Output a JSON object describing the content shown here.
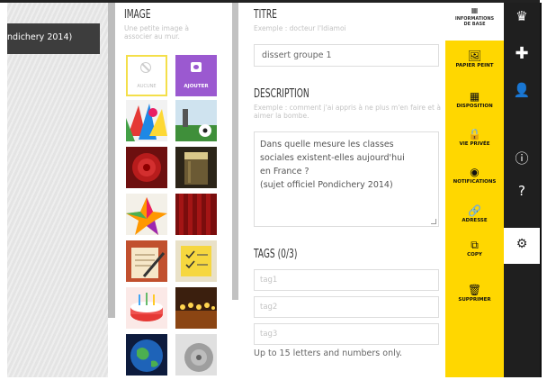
{
  "background_text": "ndichery 2014)",
  "image_section": {
    "title": "IMAGE",
    "hint": "Une petite image à associer au mur.",
    "none_label": "AUCUNE",
    "add_label": "AJOUTER",
    "thumbnails": [
      {
        "name": "thumb-colorful-figures"
      },
      {
        "name": "thumb-soccer"
      },
      {
        "name": "thumb-red-rose"
      },
      {
        "name": "thumb-beer-glass"
      },
      {
        "name": "thumb-origami-star"
      },
      {
        "name": "thumb-red-curtain"
      },
      {
        "name": "thumb-writing"
      },
      {
        "name": "thumb-sticky-note"
      },
      {
        "name": "thumb-birthday-cake"
      },
      {
        "name": "thumb-candles"
      },
      {
        "name": "thumb-earth"
      },
      {
        "name": "thumb-grey-object"
      }
    ]
  },
  "title_section": {
    "title": "TITRE",
    "hint": "Exemple : docteur l'Idiamoi",
    "value": "dissert groupe 1"
  },
  "description_section": {
    "title": "DESCRIPTION",
    "hint": "Exemple : comment j'ai appris à ne plus m'en faire et à aimer la bombe.",
    "lines": [
      "Dans quelle mesure les classes",
      "sociales existent-elles aujourd'hui",
      "en France ?",
      "(sujet officiel Pondichery 2014)"
    ]
  },
  "tags_section": {
    "title": "TAGS (0/3)",
    "placeholders": [
      "tag1",
      "tag2",
      "tag3"
    ],
    "note": "Up to 15 letters and numbers only."
  },
  "menu": {
    "top_label_1": "INFORMATIONS",
    "top_label_2": "DE BASE",
    "items": [
      {
        "label": "PAPIER PEINT",
        "icon": "image-icon"
      },
      {
        "label": "DISPOSITION",
        "icon": "layout-icon"
      },
      {
        "label": "VIE PRIVÉE",
        "icon": "lock-icon"
      },
      {
        "label": "NOTIFICATIONS",
        "icon": "eye-icon"
      },
      {
        "label": "ADRESSE",
        "icon": "link-icon"
      },
      {
        "label": "COPY",
        "icon": "copy-icon"
      },
      {
        "label": "SUPPRIMER",
        "icon": "trash-icon"
      }
    ]
  },
  "sidebar_icons": [
    "crown-icon",
    "plus-icon",
    "user-icon",
    "info-icon",
    "help-icon",
    "gear-icon"
  ],
  "colors": {
    "accent": "#ffd700",
    "dark": "#1f1f1f",
    "add_tile": "#9b59d0",
    "selected_border": "#f4df4a"
  }
}
